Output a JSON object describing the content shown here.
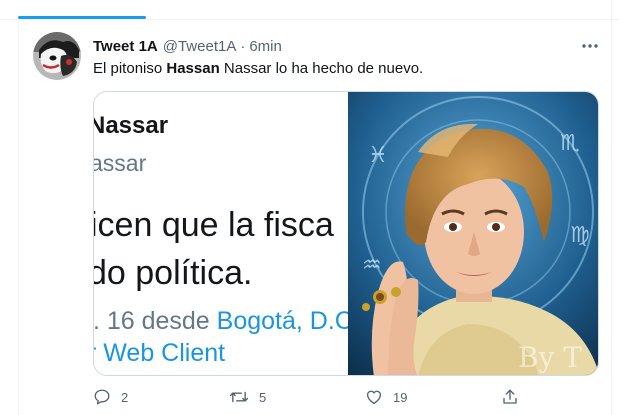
{
  "tweet": {
    "author_name": "Tweet 1A",
    "author_handle": "@Tweet1A",
    "separator": "·",
    "time": "6min",
    "text_before": "El pitoniso ",
    "text_bold": "Hassan",
    "text_after": " Nassar lo ha hecho de nuevo."
  },
  "media": {
    "name": "Nassar",
    "handle": "assar",
    "body_line1": "icen que la fisca",
    "body_line2": "do política.",
    "meta_prefix": "r. 16 desde ",
    "meta_link": "Bogotá, D.C",
    "client": "r Web Client",
    "watermark": "By T"
  },
  "actions": {
    "reply_count": "2",
    "retweet_count": "5",
    "like_count": "19"
  },
  "icons": {
    "more": "more-icon",
    "reply": "reply-icon",
    "retweet": "retweet-icon",
    "like": "like-icon",
    "share": "share-icon"
  },
  "colors": {
    "accent": "#1d9bf0",
    "muted": "#536471",
    "link": "#1b95e0"
  }
}
